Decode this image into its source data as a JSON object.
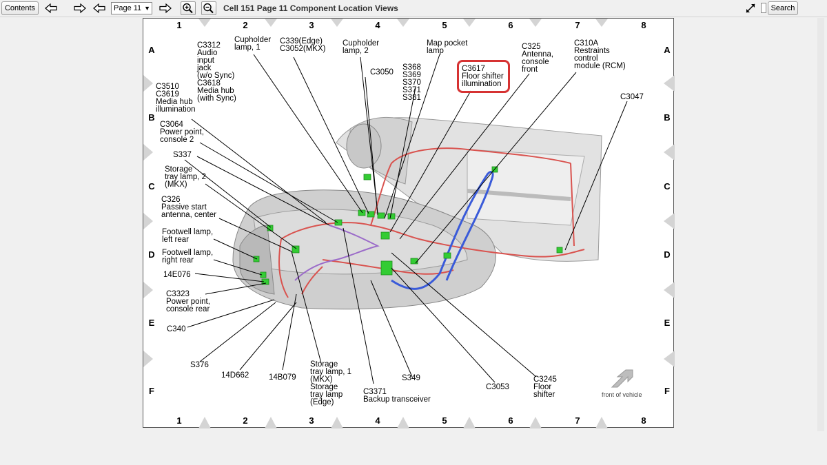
{
  "toolbar": {
    "contents_label": "Contents",
    "page_select_value": "Page 11",
    "title": "Cell 151 Page 11 Component Location Views",
    "search_label": "Search"
  },
  "grid": {
    "columns": [
      "1",
      "2",
      "3",
      "4",
      "5",
      "6",
      "7",
      "8"
    ],
    "rows": [
      "A",
      "B",
      "C",
      "D",
      "E",
      "F"
    ]
  },
  "callouts": {
    "c3312": [
      "C3312",
      "Audio",
      "input",
      "jack",
      "(w/o Sync)",
      "C3618",
      "Media hub",
      "(with Sync)"
    ],
    "cupholder1": [
      "Cupholder",
      "lamp, 1"
    ],
    "c339": [
      "C339(Edge)",
      "C3052(MKX)"
    ],
    "cupholder2": [
      "Cupholder",
      "lamp, 2"
    ],
    "map_pocket": [
      "Map pocket",
      "lamp"
    ],
    "c3050": [
      "C3050"
    ],
    "s368": [
      "S368",
      "S369",
      "S370",
      "S371",
      "S381"
    ],
    "c3617": [
      "C3617",
      "Floor shifter",
      "illumination"
    ],
    "c325": [
      "C325",
      "Antenna,",
      "console",
      "front"
    ],
    "c310a": [
      "C310A",
      "Restraints",
      "control",
      "module (RCM)"
    ],
    "c3047": [
      "C3047"
    ],
    "c3510": [
      "C3510",
      "C3619",
      "Media hub",
      "illumination"
    ],
    "c3064": [
      "C3064",
      "Power point,",
      "console 2"
    ],
    "s337": [
      "S337"
    ],
    "storage2": [
      "Storage",
      "tray lamp, 2",
      "(MKX)"
    ],
    "c326": [
      "C326",
      "Passive start",
      "antenna, center"
    ],
    "footwell_left": [
      "Footwell lamp,",
      "left rear"
    ],
    "footwell_right": [
      "Footwell lamp,",
      "right rear"
    ],
    "e14076": [
      "14E076"
    ],
    "c3323": [
      "C3323",
      "Power point,",
      "console rear"
    ],
    "c340": [
      "C340"
    ],
    "s376": [
      "S376"
    ],
    "d662": [
      "14D662"
    ],
    "b079": [
      "14B079"
    ],
    "storage1": [
      "Storage",
      "tray lamp, 1",
      "(MKX)",
      "Storage",
      "tray lamp",
      "(Edge)"
    ],
    "c3371": [
      "C3371",
      "Backup transceiver"
    ],
    "s349": [
      "S349"
    ],
    "c3053": [
      "C3053"
    ],
    "c3245": [
      "C3245",
      "Floor",
      "shifter"
    ]
  },
  "front_of_vehicle": "front of vehicle",
  "colors": {
    "highlight": "#d63232",
    "wire_red": "#d9534f",
    "wire_blue": "#3a5bd9",
    "wire_purple": "#9b6bc9",
    "connector": "#33cc33"
  }
}
